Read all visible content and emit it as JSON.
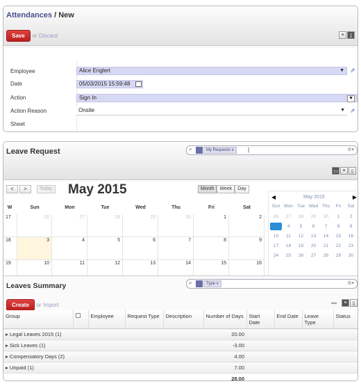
{
  "form": {
    "breadcrumb_parent": "Attendances",
    "breadcrumb_sep": "/",
    "breadcrumb_current": "New",
    "save_label": "Save",
    "or_label": "or",
    "discard_label": "Discard",
    "fields": [
      {
        "label": "Employee",
        "value": "Alice Englert"
      },
      {
        "label": "Date",
        "value": "05/03/2015 15:59:48"
      },
      {
        "label": "Action",
        "value": "Sign In"
      },
      {
        "label": "Action Reason",
        "value": "Onsite"
      },
      {
        "label": "Sheet",
        "value": ""
      }
    ]
  },
  "leave": {
    "title": "Leave Request",
    "search_facet": "My Requests",
    "search_facet_close": "x",
    "prev_label": "<",
    "next_label": ">",
    "today_label": "Today",
    "month_title": "May 2015",
    "view_month": "Month",
    "view_week": "Week",
    "view_day": "Day",
    "week_col": "W",
    "day_names": [
      "Sun",
      "Mon",
      "Tue",
      "Wed",
      "Thu",
      "Fri",
      "Sat"
    ],
    "weeks": [
      {
        "w": "17",
        "days": [
          "26",
          "27",
          "28",
          "29",
          "30",
          "1",
          "2"
        ]
      },
      {
        "w": "18",
        "days": [
          "3",
          "4",
          "5",
          "6",
          "7",
          "8",
          "9"
        ]
      },
      {
        "w": "19",
        "days": [
          "10",
          "11",
          "12",
          "13",
          "14",
          "15",
          "16"
        ]
      }
    ],
    "mini": {
      "title": "May 2015",
      "prev": "◀",
      "next": "▶",
      "days": [
        "Sun",
        "Mon",
        "Tue",
        "Wed",
        "Thu",
        "Fri",
        "Sat"
      ],
      "rows": [
        [
          "26",
          "27",
          "28",
          "29",
          "30",
          "1",
          "2"
        ],
        [
          "3",
          "4",
          "5",
          "6",
          "7",
          "8",
          "9"
        ],
        [
          "10",
          "11",
          "12",
          "13",
          "14",
          "15",
          "16"
        ],
        [
          "17",
          "18",
          "19",
          "20",
          "21",
          "22",
          "23"
        ],
        [
          "24",
          "25",
          "26",
          "27",
          "28",
          "29",
          "30"
        ]
      ]
    }
  },
  "summary": {
    "title": "Leaves Summary",
    "search_facet": "Type",
    "search_facet_close": "x",
    "create_label": "Create",
    "or_label": "or",
    "import_label": "Import",
    "columns": [
      "Group",
      "Employee",
      "Request Type",
      "Description",
      "Number of Days",
      "Start Date",
      "End Date",
      "Leave Type",
      "Status"
    ],
    "groups": [
      {
        "name": "Legal Leaves 2015 (1)",
        "days": "20.00"
      },
      {
        "name": "Sick Leaves (1)",
        "days": "-3.00"
      },
      {
        "name": "Compensatory Days (2)",
        "days": "4.00"
      },
      {
        "name": "Unpaid (1)",
        "days": "7.00"
      }
    ],
    "total": "28.00"
  }
}
